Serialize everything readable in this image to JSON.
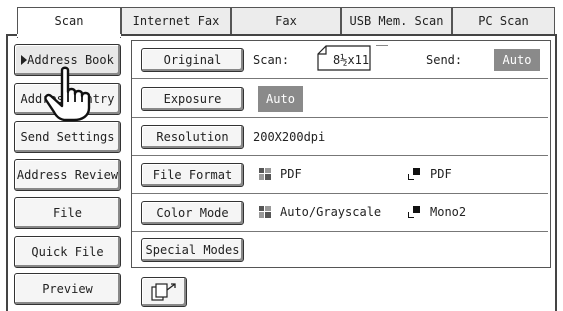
{
  "tabs": [
    {
      "label": "Scan",
      "active": true
    },
    {
      "label": "Internet Fax",
      "active": false
    },
    {
      "label": "Fax",
      "active": false
    },
    {
      "label": "USB Mem. Scan",
      "active": false
    },
    {
      "label": "PC Scan",
      "active": false
    }
  ],
  "sidebar": {
    "items": [
      {
        "label": "Address Book"
      },
      {
        "label": "Address Entry"
      },
      {
        "label": "Send Settings"
      },
      {
        "label": "Address Review"
      },
      {
        "label": "File"
      },
      {
        "label": "Quick File"
      },
      {
        "label": "Preview"
      }
    ]
  },
  "settings": {
    "original": {
      "button": "Original",
      "scan_label": "Scan:",
      "scan_size": "8½x11",
      "send_label": "Send:",
      "send_value": "Auto"
    },
    "exposure": {
      "button": "Exposure",
      "value": "Auto"
    },
    "resolution": {
      "button": "Resolution",
      "value": "200X200dpi"
    },
    "file_format": {
      "button": "File Format",
      "value_1": "PDF",
      "value_2": "PDF"
    },
    "color_mode": {
      "button": "Color Mode",
      "value_1": "Auto/Grayscale",
      "value_2": "Mono2"
    },
    "special_modes": {
      "button": "Special Modes"
    }
  },
  "colors": {
    "badge": "#8a8a8a",
    "border": "#444444"
  }
}
